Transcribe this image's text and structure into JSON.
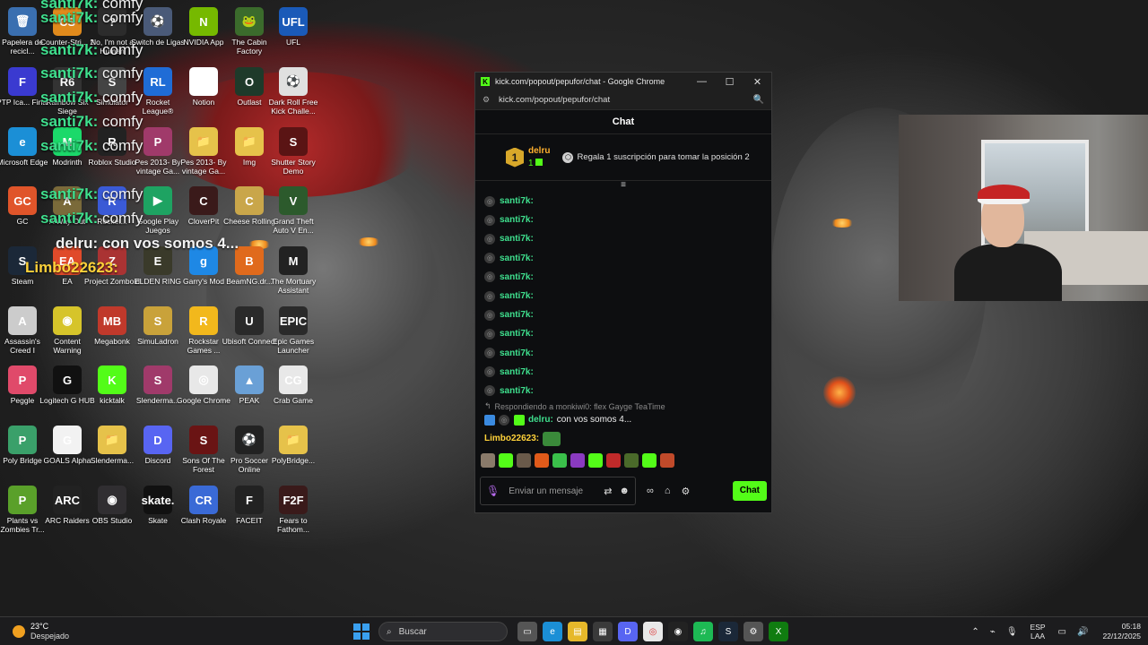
{
  "desktop": {
    "icons": [
      {
        "label": "Papelera de recicl...",
        "color": "#3a6fb0",
        "glyph": "🗑"
      },
      {
        "label": "Counter-Stri... 2",
        "color": "#e08a1c",
        "glyph": "CS"
      },
      {
        "label": "No, I'm not a Human",
        "color": "#2c2c2c",
        "glyph": "?"
      },
      {
        "label": "Switch de Ligas",
        "color": "#4a5a78",
        "glyph": "⚽"
      },
      {
        "label": "NVIDIA App",
        "color": "#76b900",
        "glyph": "N"
      },
      {
        "label": "The Cabin Factory",
        "color": "#3b6b2c",
        "glyph": "🐸"
      },
      {
        "label": "UFL",
        "color": "#1a5ab8",
        "glyph": "UFL"
      },
      {
        "label": "PTP Ica... Final",
        "color": "#3a3ad0",
        "glyph": "F"
      },
      {
        "label": "Rainbow Six Siege",
        "color": "#333",
        "glyph": "R6"
      },
      {
        "label": "Simulator",
        "color": "#444",
        "glyph": "S"
      },
      {
        "label": "Rocket League®",
        "color": "#1f6cd6",
        "glyph": "RL"
      },
      {
        "label": "Notion",
        "color": "#ffffff",
        "glyph": "N"
      },
      {
        "label": "Outlast",
        "color": "#1e3a2a",
        "glyph": "O"
      },
      {
        "label": "Dark Roll Free Kick Challe...",
        "color": "#e0e0e0",
        "glyph": "⚽"
      },
      {
        "label": "Microsoft Edge",
        "color": "#1b8fd6",
        "glyph": "e"
      },
      {
        "label": "Modrinth",
        "color": "#1bd96a",
        "glyph": "M"
      },
      {
        "label": "Roblox Studio",
        "color": "#222",
        "glyph": "R"
      },
      {
        "label": "Pes 2013- By vintage Ga...",
        "color": "#a03a6a",
        "glyph": "P"
      },
      {
        "label": "Pes 2013- By vintage Ga...",
        "color": "#e6c24a",
        "glyph": "📁"
      },
      {
        "label": "Img",
        "color": "#e6c24a",
        "glyph": "📁"
      },
      {
        "label": "Shutter Story Demo",
        "color": "#5a1414",
        "glyph": "S"
      },
      {
        "label": "GC",
        "color": "#e0552a",
        "glyph": "GC"
      },
      {
        "label": "A Way Out",
        "color": "#7a6a3a",
        "glyph": "A"
      },
      {
        "label": "Rocket...",
        "color": "#3a5ad6",
        "glyph": "R"
      },
      {
        "label": "Google Play Juegos",
        "color": "#1ea362",
        "glyph": "▶"
      },
      {
        "label": "CloverPit",
        "color": "#3a1a1a",
        "glyph": "C"
      },
      {
        "label": "Cheese Rolling",
        "color": "#c9a64a",
        "glyph": "C"
      },
      {
        "label": "Grand Theft Auto V En...",
        "color": "#2c5a2c",
        "glyph": "V"
      },
      {
        "label": "Steam",
        "color": "#1b2838",
        "glyph": "S"
      },
      {
        "label": "EA",
        "color": "#e04a2a",
        "glyph": "EA"
      },
      {
        "label": "Project Zomboid",
        "color": "#a33",
        "glyph": "Z"
      },
      {
        "label": "ELDEN RING",
        "color": "#3a3a2a",
        "glyph": "E"
      },
      {
        "label": "Garry's Mod",
        "color": "#1e88e5",
        "glyph": "g"
      },
      {
        "label": "BeamNG.dr...",
        "color": "#e06a1c",
        "glyph": "B"
      },
      {
        "label": "The Mortuary Assistant",
        "color": "#222",
        "glyph": "M"
      },
      {
        "label": "Assassin's Creed I",
        "color": "#ccc",
        "glyph": "A"
      },
      {
        "label": "Content Warning",
        "color": "#d6c42a",
        "glyph": "◉"
      },
      {
        "label": "Megabonk",
        "color": "#c0392b",
        "glyph": "MB"
      },
      {
        "label": "SimuLadron",
        "color": "#c9a23a",
        "glyph": "S"
      },
      {
        "label": "Rockstar Games ...",
        "color": "#f2b81c",
        "glyph": "R"
      },
      {
        "label": "Ubisoft Connect",
        "color": "#2a2a2a",
        "glyph": "U"
      },
      {
        "label": "Epic Games Launcher",
        "color": "#2a2a2a",
        "glyph": "EPIC"
      },
      {
        "label": "Peggle",
        "color": "#e04a6a",
        "glyph": "P"
      },
      {
        "label": "Logitech G HUB",
        "color": "#111",
        "glyph": "G"
      },
      {
        "label": "kicktalk",
        "color": "#53fc18",
        "glyph": "K"
      },
      {
        "label": "Slenderma...",
        "color": "#a03a6a",
        "glyph": "S"
      },
      {
        "label": "Google Chrome",
        "color": "#e8e8e8",
        "glyph": "◎"
      },
      {
        "label": "PEAK",
        "color": "#6aa0d6",
        "glyph": "▲"
      },
      {
        "label": "Crab Game",
        "color": "#e8e8e8",
        "glyph": "CG"
      },
      {
        "label": "Poly Bridge",
        "color": "#3aa06a",
        "glyph": "P"
      },
      {
        "label": "GOALS Alpha",
        "color": "#f2f2f2",
        "glyph": "G"
      },
      {
        "label": "Slenderma...",
        "color": "#e6c24a",
        "glyph": "📁"
      },
      {
        "label": "Discord",
        "color": "#5865f2",
        "glyph": "D"
      },
      {
        "label": "Sons Of The Forest",
        "color": "#6a1414",
        "glyph": "S"
      },
      {
        "label": "Pro Soccer Online",
        "color": "#222",
        "glyph": "⚽"
      },
      {
        "label": "PolyBridge...",
        "color": "#e6c24a",
        "glyph": "📁"
      },
      {
        "label": "Plants vs Zombies Tr...",
        "color": "#5aa02a",
        "glyph": "P"
      },
      {
        "label": "ARC Raiders",
        "color": "#222",
        "glyph": "ARC"
      },
      {
        "label": "OBS Studio",
        "color": "#302e31",
        "glyph": "◉"
      },
      {
        "label": "Skate",
        "color": "#111",
        "glyph": "skate."
      },
      {
        "label": "Clash Royale",
        "color": "#3a6ad6",
        "glyph": "CR"
      },
      {
        "label": "FACEIT",
        "color": "#222",
        "glyph": "F"
      },
      {
        "label": "Fears to Fathom...",
        "color": "#3a1a1a",
        "glyph": "F2F"
      }
    ]
  },
  "overlay": {
    "user": "santi7k:",
    "word": "comfy",
    "line_delru": "delru: con vos somos 4...",
    "line_limbo": "Limbo22623:"
  },
  "window": {
    "title": "kick.com/popout/pepufor/chat - Google Chrome",
    "url": "kick.com/popout/pepufor/chat",
    "minimize": "—",
    "maximize": "☐",
    "close": "✕"
  },
  "chat": {
    "header": "Chat",
    "pinned": {
      "rank": "1",
      "username": "delru",
      "count": "1",
      "message": "Regala 1 suscripción para tomar la posición 2"
    },
    "messages": [
      {
        "user": "santi7k:"
      },
      {
        "user": "santi7k:"
      },
      {
        "user": "santi7k:"
      },
      {
        "user": "santi7k:"
      },
      {
        "user": "santi7k:"
      },
      {
        "user": "santi7k:"
      },
      {
        "user": "santi7k:"
      },
      {
        "user": "santi7k:"
      },
      {
        "user": "santi7k:"
      },
      {
        "user": "santi7k:"
      },
      {
        "user": "santi7k:"
      }
    ],
    "reply_to": "Respondiendo a monkiwi0: flex Gayge TeaTime",
    "reply_user": "delru:",
    "reply_text": "con vos somos 4...",
    "last_user": "Limbo22623:",
    "input_placeholder": "Enviar un mensaje",
    "send_label": "Chat"
  },
  "taskbar": {
    "temp": "23°C",
    "condition": "Despejado",
    "search_placeholder": "Buscar",
    "lang_top": "ESP",
    "lang_bottom": "LAA",
    "time": "05:18",
    "date": "22/12/2025"
  }
}
